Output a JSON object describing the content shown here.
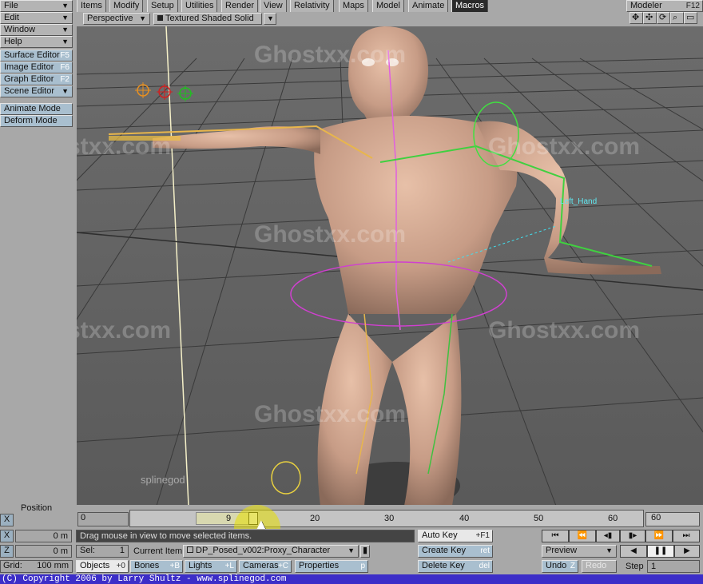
{
  "left_menu": [
    {
      "label": "File"
    },
    {
      "label": "Edit"
    },
    {
      "label": "Window"
    },
    {
      "label": "Help"
    }
  ],
  "left_tools": [
    {
      "label": "Surface Editor",
      "shortcut": "F5"
    },
    {
      "label": "Image Editor",
      "shortcut": "F6"
    },
    {
      "label": "Graph Editor",
      "shortcut": "F2"
    },
    {
      "label": "Scene Editor",
      "shortcut": ""
    }
  ],
  "mode_buttons": [
    {
      "label": "Animate Mode"
    },
    {
      "label": "Deform Mode"
    }
  ],
  "tabs": [
    "Items",
    "Modify",
    "Setup",
    "Utilities",
    "Render",
    "View",
    "Relativity",
    "Maps",
    "Model",
    "Animate",
    "Macros"
  ],
  "active_tab": "Macros",
  "modeler_button": {
    "label": "Modeler",
    "shortcut": "F12"
  },
  "viewport": {
    "view_mode": "Perspective",
    "shading_mode": "Textured Shaded Solid",
    "bone_label": "Left_Hand",
    "watermark": "Ghostxx.com",
    "logo_text": "splinegod"
  },
  "position_panel": {
    "title": "Position",
    "x_label": "X",
    "x_value": "0 m",
    "y_label": "Y",
    "y_value": "0 m",
    "z_label": "Z",
    "z_value": "0 m",
    "grid_label": "Grid:",
    "grid_value": "100 mm"
  },
  "timeline": {
    "start": "0",
    "current": "9",
    "end": "60",
    "ticks": [
      "20",
      "30",
      "40",
      "50",
      "60"
    ],
    "progress": 0.15
  },
  "status": {
    "message": "Drag mouse in view to move selected items.",
    "sel_label": "Sel:",
    "sel_value": "1",
    "current_item_label": "Current Item",
    "current_item_value": "DP_Posed_v002:Proxy_Character"
  },
  "filters": [
    {
      "label": "Objects",
      "count": "+0"
    },
    {
      "label": "Bones",
      "count": "+B"
    },
    {
      "label": "Lights",
      "count": "+L"
    },
    {
      "label": "Cameras",
      "count": "+C"
    }
  ],
  "properties": {
    "label": "Properties",
    "shortcut": "p"
  },
  "keys": [
    {
      "label": "Auto Key",
      "shortcut": "+F1"
    },
    {
      "label": "Create Key",
      "shortcut": "ret"
    },
    {
      "label": "Delete Key",
      "shortcut": "del"
    }
  ],
  "playback": {
    "preview_label": "Preview",
    "undo_label": "Undo",
    "undo_shortcut": "Z",
    "redo_label": "Redo",
    "step_label": "Step",
    "step_value": "1"
  },
  "copyright": "(C) Copyright 2006 by Larry Shultz  - www.splinegod.com"
}
